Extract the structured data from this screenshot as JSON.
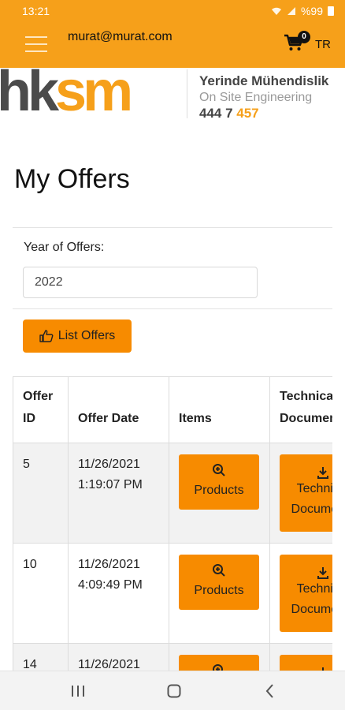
{
  "status_bar": {
    "time": "13:21",
    "battery_text": "%99",
    "icons": [
      "wifi-icon",
      "signal-icon",
      "battery-icon"
    ]
  },
  "header": {
    "menu_icon": "hamburger-icon",
    "user_email": "murat@murat.com",
    "cart_icon": "cart-icon",
    "cart_count": "0",
    "language": "TR"
  },
  "logo": {
    "text_dark": "hk",
    "text_accent": "sm",
    "tagline_title": "Yerinde Mühendislik",
    "tagline_subtitle": "On Site Engineering",
    "phone_main": "444 7 ",
    "phone_accent": "457"
  },
  "page": {
    "title": "My Offers"
  },
  "filter": {
    "label": "Year of Offers:",
    "year_value": "2022",
    "list_button_label": "List Offers",
    "list_button_icon": "thumbs-up-icon"
  },
  "table": {
    "headers": {
      "offer_id": "Offer ID",
      "offer_date": "Offer Date",
      "items": "Items",
      "technical_documents": "Technical Documents"
    },
    "product_button_label": "Products",
    "product_button_icon": "zoom-in-icon",
    "tech_button_label": "Technical Documents",
    "tech_button_icon": "download-icon",
    "rows": [
      {
        "offer_id": "5",
        "date": "11/26/2021",
        "time": "1:19:07 PM"
      },
      {
        "offer_id": "10",
        "date": "11/26/2021",
        "time": "4:09:49 PM"
      },
      {
        "offer_id": "14",
        "date": "11/26/2021",
        "time": ""
      }
    ]
  },
  "nav_bar": {
    "buttons": [
      "recent-apps-icon",
      "home-icon",
      "back-icon"
    ]
  },
  "colors": {
    "brand_orange": "#f6a01a",
    "button_orange": "#f78b00",
    "logo_gray": "#4b4b4b"
  }
}
